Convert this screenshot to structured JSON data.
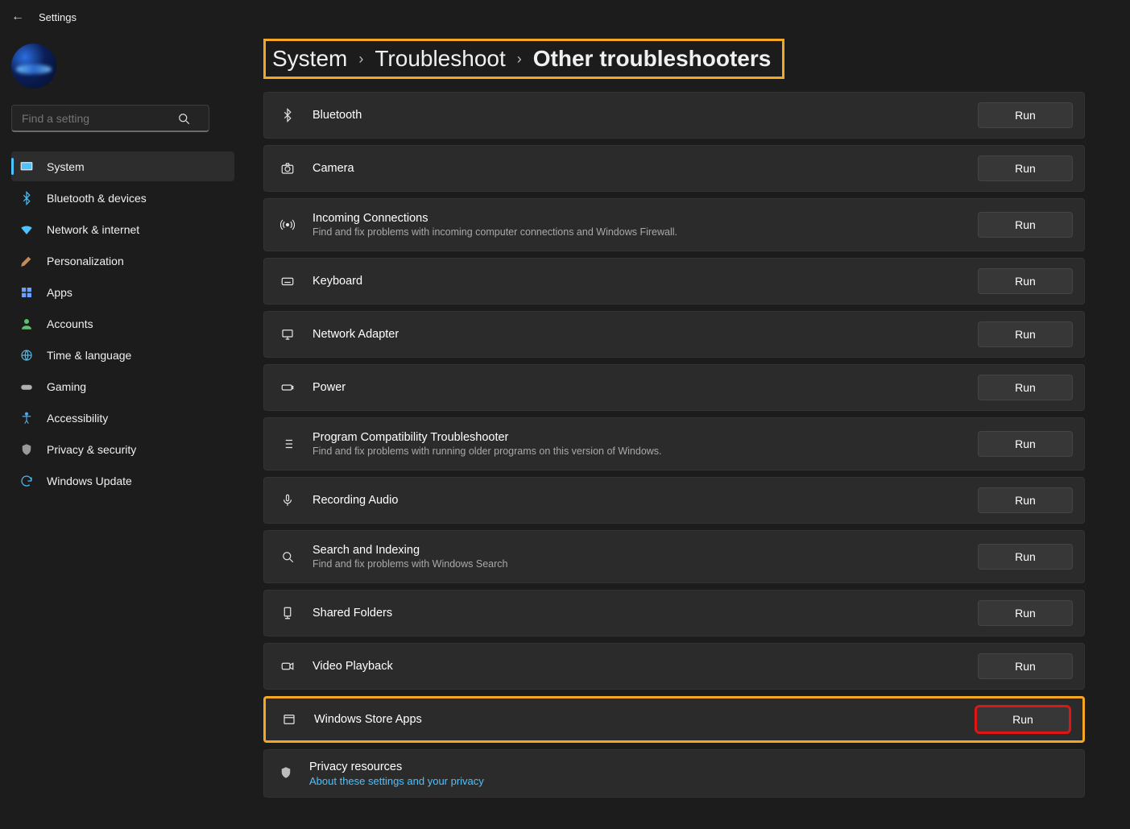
{
  "window": {
    "title": "Settings"
  },
  "search": {
    "placeholder": "Find a setting"
  },
  "sidebar": {
    "items": [
      {
        "label": "System",
        "icon": "💻",
        "active": true
      },
      {
        "label": "Bluetooth & devices",
        "icon": "bt",
        "active": false
      },
      {
        "label": "Network & internet",
        "icon": "wifi",
        "active": false
      },
      {
        "label": "Personalization",
        "icon": "pers",
        "active": false
      },
      {
        "label": "Apps",
        "icon": "apps",
        "active": false
      },
      {
        "label": "Accounts",
        "icon": "acct",
        "active": false
      },
      {
        "label": "Time & language",
        "icon": "time",
        "active": false
      },
      {
        "label": "Gaming",
        "icon": "game",
        "active": false
      },
      {
        "label": "Accessibility",
        "icon": "acc",
        "active": false
      },
      {
        "label": "Privacy & security",
        "icon": "priv",
        "active": false
      },
      {
        "label": "Windows Update",
        "icon": "upd",
        "active": false
      }
    ]
  },
  "breadcrumb": {
    "part1": "System",
    "part2": "Troubleshoot",
    "part3": "Other troubleshooters"
  },
  "run_label": "Run",
  "troubleshooters": [
    {
      "title": "Bluetooth",
      "sub": "",
      "icon": "bluetooth"
    },
    {
      "title": "Camera",
      "sub": "",
      "icon": "camera"
    },
    {
      "title": "Incoming Connections",
      "sub": "Find and fix problems with incoming computer connections and Windows Firewall.",
      "icon": "signal"
    },
    {
      "title": "Keyboard",
      "sub": "",
      "icon": "keyboard"
    },
    {
      "title": "Network Adapter",
      "sub": "",
      "icon": "network"
    },
    {
      "title": "Power",
      "sub": "",
      "icon": "power"
    },
    {
      "title": "Program Compatibility Troubleshooter",
      "sub": "Find and fix problems with running older programs on this version of Windows.",
      "icon": "list"
    },
    {
      "title": "Recording Audio",
      "sub": "",
      "icon": "mic"
    },
    {
      "title": "Search and Indexing",
      "sub": "Find and fix problems with Windows Search",
      "icon": "search"
    },
    {
      "title": "Shared Folders",
      "sub": "",
      "icon": "share"
    },
    {
      "title": "Video Playback",
      "sub": "",
      "icon": "video"
    },
    {
      "title": "Windows Store Apps",
      "sub": "",
      "icon": "store"
    }
  ],
  "privacy": {
    "title": "Privacy resources",
    "link": "About these settings and your privacy"
  }
}
